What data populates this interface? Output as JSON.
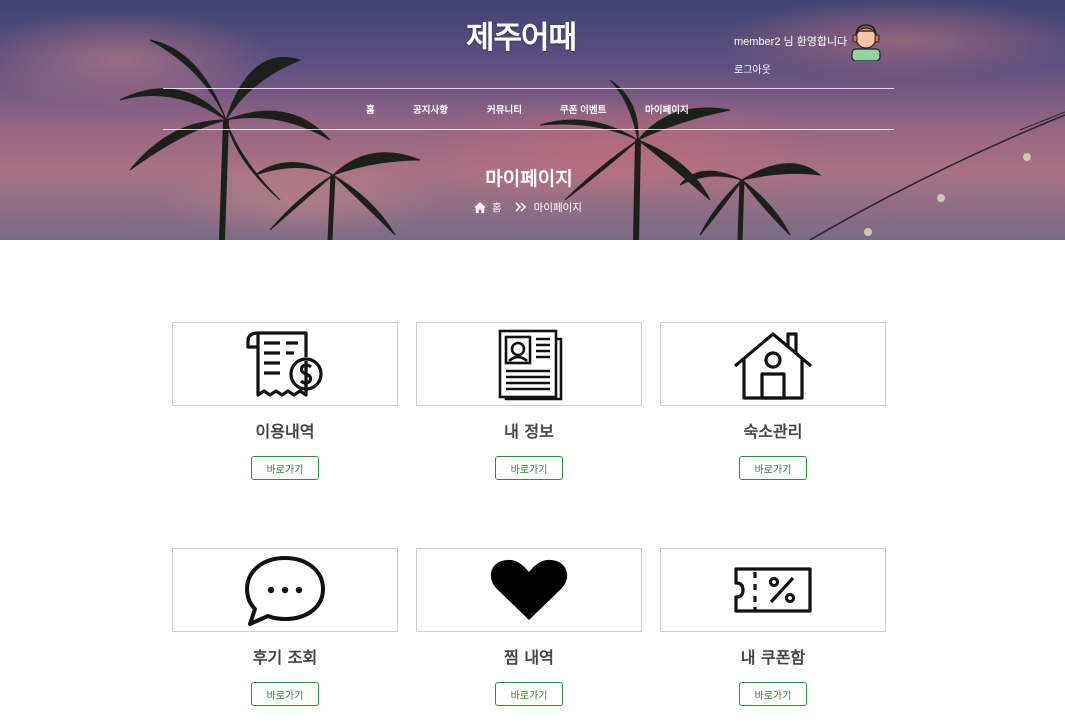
{
  "header": {
    "logo": "제주어때",
    "welcome": "member2 님 환영합니다",
    "logout": "로그아웃"
  },
  "nav": {
    "items": [
      {
        "label": "홈"
      },
      {
        "label": "공지사항"
      },
      {
        "label": "커뮤니티"
      },
      {
        "label": "쿠폰 이벤트"
      },
      {
        "label": "마이페이지"
      }
    ]
  },
  "hero": {
    "title": "마이페이지",
    "breadcrumb": {
      "home": "홈",
      "current": "마이페이지"
    }
  },
  "cards": [
    {
      "label": "이용내역",
      "button": "바로가기",
      "icon": "receipt-dollar-icon"
    },
    {
      "label": "내 정보",
      "button": "바로가기",
      "icon": "profile-document-icon"
    },
    {
      "label": "숙소관리",
      "button": "바로가기",
      "icon": "house-icon"
    },
    {
      "label": "후기 조회",
      "button": "바로가기",
      "icon": "chat-bubble-icon"
    },
    {
      "label": "찜 내역",
      "button": "바로가기",
      "icon": "heart-icon"
    },
    {
      "label": "내 쿠폰함",
      "button": "바로가기",
      "icon": "coupon-icon"
    }
  ],
  "colors": {
    "accent_green": "#2e7d32",
    "border": "#cfcfcf"
  }
}
